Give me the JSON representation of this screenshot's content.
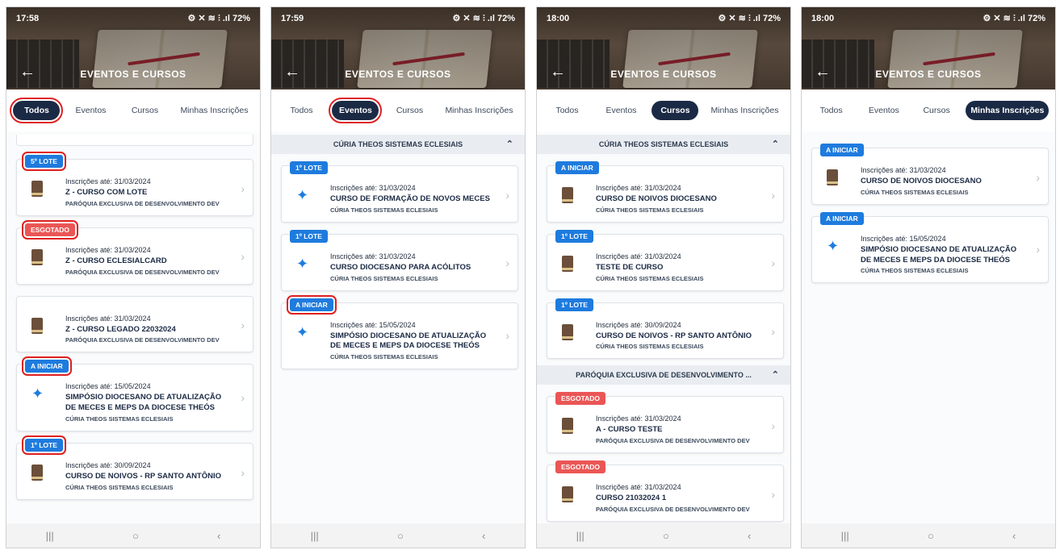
{
  "screens": [
    {
      "time": "17:58",
      "status_icons": "⚙ ✕ ≋ ⫶ .ıl 72%",
      "title": "EVENTOS E CURSOS",
      "tabs": [
        "Todos",
        "Eventos",
        "Cursos",
        "Minhas Inscrições"
      ],
      "active_tab": 0,
      "cards": [
        {
          "badge": "5º LOTE",
          "badge_color": "blue",
          "date": "Inscrições até: 31/03/2024",
          "name": "Z - CURSO COM LOTE",
          "org": "PARÓQUIA EXCLUSIVA DE DESENVOLVIMENTO DEV",
          "icon": "book-icon"
        },
        {
          "badge": "ESGOTADO",
          "badge_color": "red",
          "date": "Inscrições até: 31/03/2024",
          "name": "Z - CURSO ECLESIALCARD",
          "org": "PARÓQUIA EXCLUSIVA DE DESENVOLVIMENTO DEV",
          "icon": "book-icon"
        },
        {
          "badge": "",
          "badge_color": "blue",
          "date": "Inscrições até: 31/03/2024",
          "name": "Z - CURSO LEGADO 22032024",
          "org": "PARÓQUIA EXCLUSIVA DE DESENVOLVIMENTO DEV",
          "icon": "book-icon"
        },
        {
          "badge": "A INICIAR",
          "badge_color": "blue",
          "date": "Inscrições até: 15/05/2024",
          "name": "SIMPÓSIO DIOCESANO DE ATUALIZAÇÃO DE MECES E MEPS DA DIOCESE THEÓS",
          "org": "CÚRIA THEOS SISTEMAS ECLESIAIS",
          "icon": "party-icon"
        },
        {
          "badge": "1º LOTE",
          "badge_color": "blue",
          "date": "Inscrições até: 30/09/2024",
          "name": "CURSO DE NOIVOS - RP SANTO ANTÔNIO",
          "org": "CÚRIA THEOS SISTEMAS ECLESIAIS",
          "icon": "book-icon"
        }
      ]
    },
    {
      "time": "17:59",
      "status_icons": "⚙ ✕ ≋ ⫶ .ıl 72%",
      "title": "EVENTOS E CURSOS",
      "tabs": [
        "Todos",
        "Eventos",
        "Cursos",
        "Minhas Inscrições"
      ],
      "active_tab": 1,
      "group": "CÚRIA THEOS SISTEMAS ECLESIAIS",
      "cards": [
        {
          "badge": "1º LOTE",
          "badge_color": "blue",
          "date": "Inscrições até: 31/03/2024",
          "name": "CURSO DE FORMAÇÃO DE NOVOS MECES",
          "org": "CÚRIA THEOS SISTEMAS ECLESIAIS",
          "icon": "party-icon"
        },
        {
          "badge": "1º LOTE",
          "badge_color": "blue",
          "date": "Inscrições até: 31/03/2024",
          "name": "CURSO DIOCESANO PARA ACÓLITOS",
          "org": "CÚRIA THEOS SISTEMAS ECLESIAIS",
          "icon": "party-icon"
        },
        {
          "badge": "A INICIAR",
          "badge_color": "blue",
          "date": "Inscrições até: 15/05/2024",
          "name": "SIMPÓSIO DIOCESANO DE ATUALIZAÇÃO DE MECES E MEPS DA DIOCESE THEÓS",
          "org": "CÚRIA THEOS SISTEMAS ECLESIAIS",
          "icon": "party-icon"
        }
      ]
    },
    {
      "time": "18:00",
      "status_icons": "⚙ ✕ ≋ ⫶ .ıl 72%",
      "title": "EVENTOS E CURSOS",
      "tabs": [
        "Todos",
        "Eventos",
        "Cursos",
        "Minhas Inscrições"
      ],
      "active_tab": 2,
      "group": "CÚRIA THEOS SISTEMAS ECLESIAIS",
      "group2": "PARÓQUIA EXCLUSIVA DE DESENVOLVIMENTO ...",
      "cards": [
        {
          "badge": "A INICIAR",
          "badge_color": "blue",
          "date": "Inscrições até: 31/03/2024",
          "name": "CURSO DE NOIVOS DIOCESANO",
          "org": "CÚRIA THEOS SISTEMAS ECLESIAIS",
          "icon": "book-icon"
        },
        {
          "badge": "1º LOTE",
          "badge_color": "blue",
          "date": "Inscrições até: 31/03/2024",
          "name": "TESTE DE CURSO",
          "org": "CÚRIA THEOS SISTEMAS ECLESIAIS",
          "icon": "book-icon"
        },
        {
          "badge": "1º LOTE",
          "badge_color": "blue",
          "date": "Inscrições até: 30/09/2024",
          "name": "CURSO DE NOIVOS - RP SANTO ANTÔNIO",
          "org": "CÚRIA THEOS SISTEMAS ECLESIAIS",
          "icon": "book-icon"
        },
        {
          "badge": "ESGOTADO",
          "badge_color": "red",
          "date": "Inscrições até: 31/03/2024",
          "name": "A - CURSO TESTE",
          "org": "PARÓQUIA EXCLUSIVA DE DESENVOLVIMENTO DEV",
          "icon": "book-icon"
        },
        {
          "badge": "ESGOTADO",
          "badge_color": "red",
          "date": "Inscrições até: 31/03/2024",
          "name": "CURSO 21032024 1",
          "org": "PARÓQUIA EXCLUSIVA DE DESENVOLVIMENTO DEV",
          "icon": "book-icon"
        }
      ]
    },
    {
      "time": "18:00",
      "status_icons": "⚙ ✕ ≋ ⫶ .ıl 72%",
      "title": "EVENTOS E CURSOS",
      "tabs": [
        "Todos",
        "Eventos",
        "Cursos",
        "Minhas Inscrições"
      ],
      "active_tab": 3,
      "cards": [
        {
          "badge": "A INICIAR",
          "badge_color": "blue",
          "date": "Inscrições até: 31/03/2024",
          "name": "CURSO DE NOIVOS DIOCESANO",
          "org": "CÚRIA THEOS SISTEMAS ECLESIAIS",
          "icon": "book-icon"
        },
        {
          "badge": "A INICIAR",
          "badge_color": "blue",
          "date": "Inscrições até: 15/05/2024",
          "name": "SIMPÓSIO DIOCESANO DE ATUALIZAÇÃO DE MECES E MEPS DA DIOCESE THEÓS",
          "org": "CÚRIA THEOS SISTEMAS ECLESIAIS",
          "icon": "party-icon"
        }
      ]
    }
  ],
  "nav": {
    "recents": "|||",
    "home": "○",
    "back": "‹"
  },
  "colors": {
    "primary": "#1b2a44",
    "badge_blue": "#1e7bde",
    "badge_red": "#ea5655",
    "highlight": "#e02020"
  }
}
